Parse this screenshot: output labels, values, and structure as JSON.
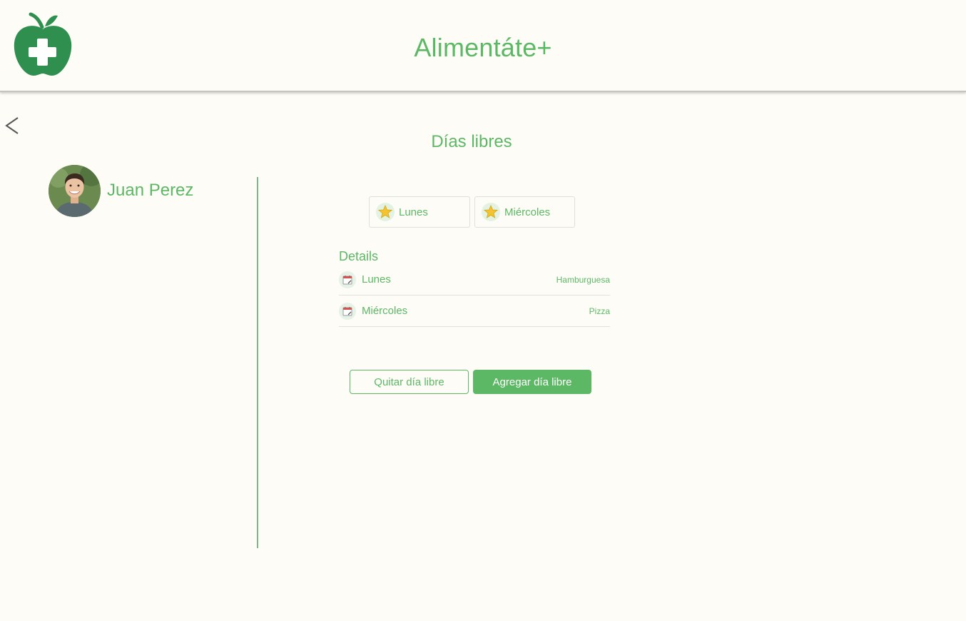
{
  "header": {
    "app_title": "Alimentáte+",
    "logo_icon": "apple-plus-logo-icon"
  },
  "nav": {
    "back_icon": "chevron-left-icon"
  },
  "page": {
    "title": "Días libres"
  },
  "user": {
    "name": "Juan Perez",
    "avatar": "user-avatar-photo"
  },
  "chips": [
    {
      "label": "Lunes",
      "icon": "star-icon"
    },
    {
      "label": "Miércoles",
      "icon": "star-icon"
    }
  ],
  "details": {
    "title": "Details",
    "rows": [
      {
        "day": "Lunes",
        "food": "Hamburguesa",
        "icon": "calendar-icon"
      },
      {
        "day": "Miércoles",
        "food": "Pizza",
        "icon": "calendar-icon"
      }
    ]
  },
  "actions": {
    "remove_label": "Quitar día libre",
    "add_label": "Agregar día libre"
  },
  "colors": {
    "accent": "#5db865",
    "logo": "#2f8f4e",
    "background": "#fdfcf7"
  }
}
